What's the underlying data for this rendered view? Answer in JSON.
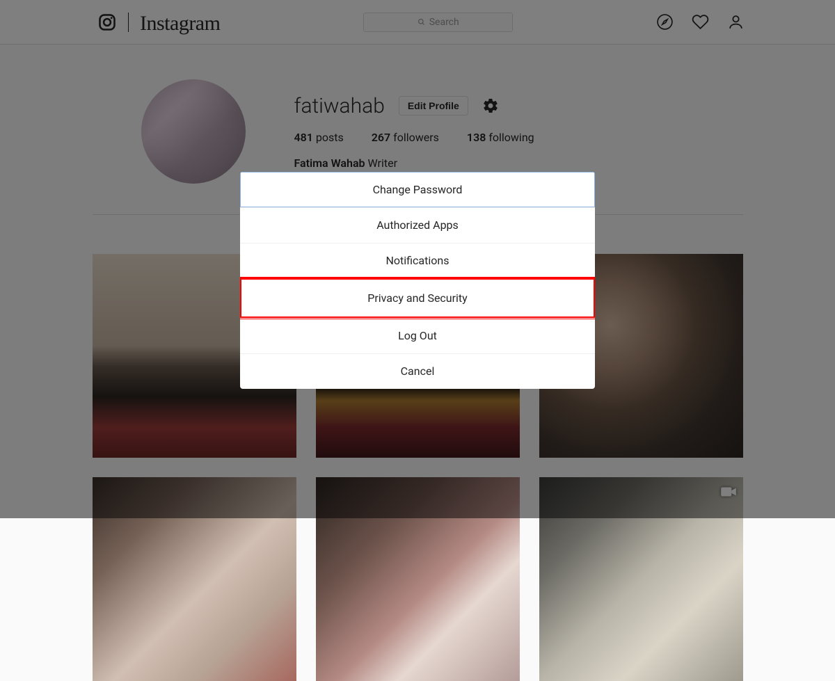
{
  "header": {
    "wordmark": "Instagram",
    "search_placeholder": "Search"
  },
  "profile": {
    "username": "fatiwahab",
    "edit_label": "Edit Profile",
    "posts_count": "481",
    "posts_label": "posts",
    "followers_count": "267",
    "followers_label": "followers",
    "following_count": "138",
    "following_label": "following",
    "full_name": "Fatima Wahab",
    "bio": "Writer"
  },
  "modal": {
    "items": [
      "Change Password",
      "Authorized Apps",
      "Notifications",
      "Privacy and Security",
      "Log Out",
      "Cancel"
    ],
    "highlight_index": 3
  }
}
